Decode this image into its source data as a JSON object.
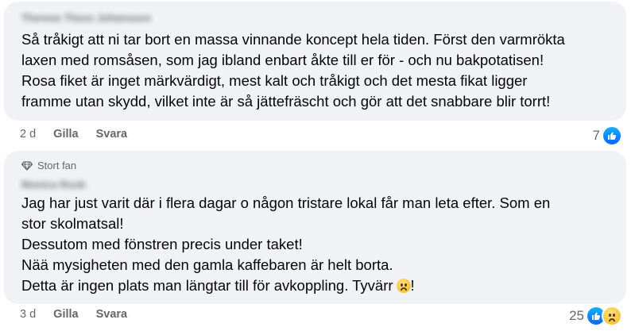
{
  "comments": [
    {
      "author": "Therese Thess Johansson",
      "text": "Så tråkigt att ni tar bort en massa vinnande koncept hela tiden. Först den varmrökta\nlaxen med romsåsen, som jag ibland enbart åkte till er för - och nu bakpotatisen!\nRosa fiket är inget märkvärdigt, mest kalt och tråkigt och det mesta fikat ligger\nframme utan skydd, vilket inte är så jättefräscht och gör att det snabbare blir torrt!",
      "age": "2 d",
      "like_label": "Gilla",
      "reply_label": "Svara",
      "reaction_count": "7",
      "reactions": [
        "like-icon"
      ]
    },
    {
      "badge": "Stort fan",
      "author": "Monica Rook",
      "text": "Jag har just varit där i flera dagar o någon tristare lokal får man leta efter. Som en\nstor skolmatsal!\nDessutom med fönstren precis under taket!\nNää mysigheten med den gamla kaffebaren är helt borta.\nDetta är ingen plats man längtar till för avkoppling. Tyvärr",
      "text_end": "!",
      "age": "3 d",
      "like_label": "Gilla",
      "reply_label": "Svara",
      "reaction_count": "25",
      "reactions": [
        "like-icon",
        "sad-icon"
      ]
    }
  ]
}
